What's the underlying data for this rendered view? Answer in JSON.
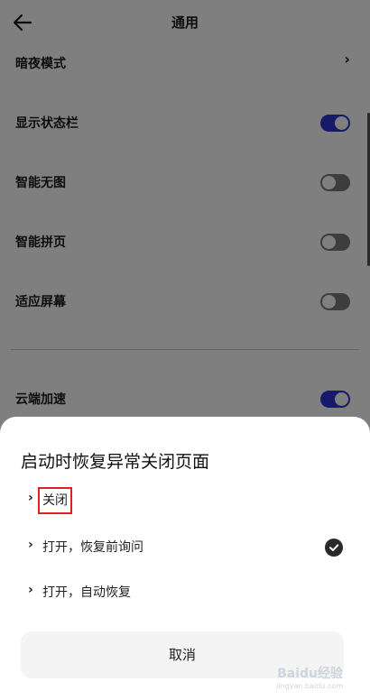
{
  "header": {
    "title": "通用",
    "back_icon": "arrow-left-icon"
  },
  "settings": [
    {
      "label": "暗夜模式",
      "control": "chevron"
    },
    {
      "label": "显示状态栏",
      "control": "toggle",
      "on": true
    },
    {
      "label": "智能无图",
      "control": "toggle",
      "on": false
    },
    {
      "label": "智能拼页",
      "control": "toggle",
      "on": false
    },
    {
      "label": "适应屏幕",
      "control": "toggle",
      "on": false
    },
    {
      "label": "云端加速",
      "control": "toggle",
      "on": true
    }
  ],
  "dialog": {
    "title": "启动时恢复异常关闭页面",
    "options": [
      {
        "label": "关闭",
        "highlighted": true,
        "selected": false
      },
      {
        "label": "打开，恢复前询问",
        "selected": true
      },
      {
        "label": "打开，自动恢复",
        "selected": false
      }
    ],
    "cancel_label": "取消"
  },
  "watermark": {
    "brand": "Baidu经验",
    "url": "jingyan.baidu.com"
  },
  "colors": {
    "toggle_on": "#2e34d6",
    "toggle_off": "#7a7a7a",
    "highlight": "#e02020"
  }
}
